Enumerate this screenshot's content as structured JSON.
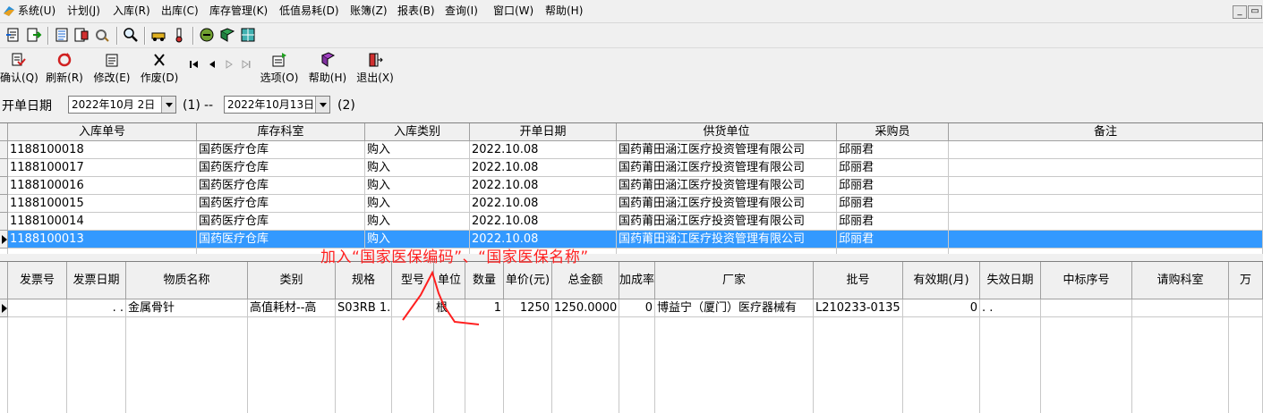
{
  "menu": [
    "系统(U)",
    "计划(J)",
    "入库(R)",
    "出库(C)",
    "库存管理(K)",
    "低值易耗(D)",
    "账簿(Z)",
    "报表(B)",
    "查询(I)",
    "窗口(W)",
    "帮助(H)"
  ],
  "window_buttons": {
    "minimize": "_",
    "restore": "▭"
  },
  "toolbar_icons": [
    "open-icon",
    "import-icon",
    "report-icon",
    "document-icon",
    "tools-icon",
    "search-icon",
    "car-icon",
    "thermometer-icon",
    "minus-circle-icon",
    "book-icon",
    "grid-icon"
  ],
  "actions": {
    "confirm": "确认(Q)",
    "refresh": "刷新(R)",
    "modify": "修改(E)",
    "void": "作废(D)",
    "options": "选项(O)",
    "help": "帮助(H)",
    "exit": "退出(X)"
  },
  "filter": {
    "label": "开单日期",
    "date_from": "2022年10月 2日",
    "paren1": "(1)",
    "separator": "--",
    "date_to": "2022年10月13日",
    "paren2": "(2)"
  },
  "top_grid": {
    "columns": [
      "入库单号",
      "库存科室",
      "入库类别",
      "开单日期",
      "供货单位",
      "采购员",
      "备注"
    ],
    "rows": [
      [
        "1188100018",
        "国药医疗仓库",
        "购入",
        "2022.10.08",
        "国药莆田涵江医疗投资管理有限公司",
        "邱丽君",
        ""
      ],
      [
        "1188100017",
        "国药医疗仓库",
        "购入",
        "2022.10.08",
        "国药莆田涵江医疗投资管理有限公司",
        "邱丽君",
        ""
      ],
      [
        "1188100016",
        "国药医疗仓库",
        "购入",
        "2022.10.08",
        "国药莆田涵江医疗投资管理有限公司",
        "邱丽君",
        ""
      ],
      [
        "1188100015",
        "国药医疗仓库",
        "购入",
        "2022.10.08",
        "国药莆田涵江医疗投资管理有限公司",
        "邱丽君",
        ""
      ],
      [
        "1188100014",
        "国药医疗仓库",
        "购入",
        "2022.10.08",
        "国药莆田涵江医疗投资管理有限公司",
        "邱丽君",
        ""
      ],
      [
        "1188100013",
        "国药医疗仓库",
        "购入",
        "2022.10.08",
        "国药莆田涵江医疗投资管理有限公司",
        "邱丽君",
        ""
      ]
    ],
    "selected_row": 5
  },
  "bottom_grid": {
    "columns": [
      "发票号",
      "发票日期",
      "物质名称",
      "类别",
      "规格",
      "型号",
      "单位",
      "数量",
      "单价(元)",
      "总金额",
      "加成率",
      "厂家",
      "批号",
      "有效期(月)",
      "失效日期",
      "中标序号",
      "请购科室",
      "万"
    ],
    "rows": [
      [
        "",
        ".   .",
        "金属骨针",
        "高值耗材--高",
        "S03RB 1.",
        "",
        "根",
        "1",
        "1250",
        "1250.0000",
        "0",
        "博益宁（厦门）医疗器械有",
        "L210233-0135",
        "0",
        ".   .",
        "",
        "",
        ""
      ]
    ]
  },
  "annotation": {
    "text": "加入“国家医保编码”、“国家医保名称”",
    "color": "#ff2020"
  }
}
